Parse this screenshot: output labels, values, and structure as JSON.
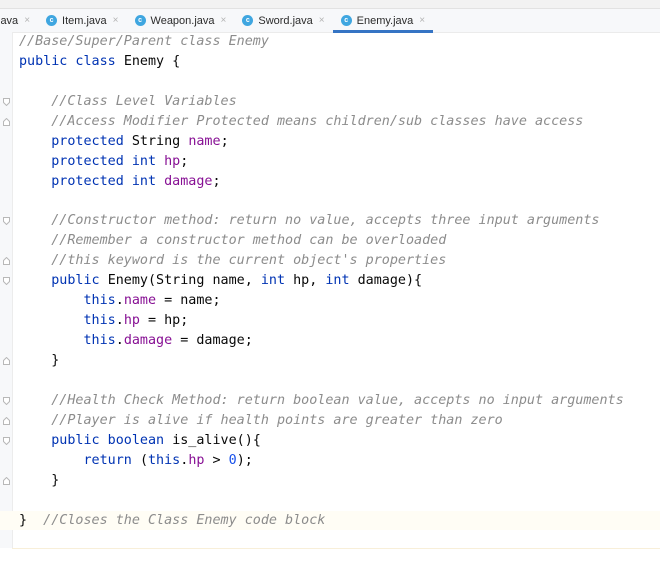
{
  "tabs": [
    {
      "label": "java",
      "icon": "java-class-icon",
      "active": false,
      "partial": true
    },
    {
      "label": "Item.java",
      "icon": "java-class-icon",
      "active": false
    },
    {
      "label": "Weapon.java",
      "icon": "java-class-icon",
      "active": false
    },
    {
      "label": "Sword.java",
      "icon": "java-class-icon",
      "active": false
    },
    {
      "label": "Enemy.java",
      "icon": "java-class-icon",
      "active": true
    }
  ],
  "tab_close_glyph": "×",
  "class_icon_glyph": "c",
  "colors": {
    "keyword": "#0033b3",
    "field": "#871094",
    "comment": "#8c8c8c",
    "number": "#1750eb",
    "text": "#080808",
    "active_tab_underline": "#3574c4",
    "class_icon": "#3fa6e0"
  },
  "editor": {
    "file_name": "Enemy.java",
    "lines": [
      [
        {
          "t": "c",
          "v": "//Base/Super/Parent class Enemy"
        }
      ],
      [
        {
          "t": "k",
          "v": "public class "
        },
        {
          "t": "t",
          "v": "Enemy {"
        }
      ],
      [],
      [
        {
          "t": "c",
          "v": "    //Class Level Variables"
        }
      ],
      [
        {
          "t": "c",
          "v": "    //Access Modifier Protected means children/sub classes have access"
        }
      ],
      [
        {
          "t": "k",
          "v": "    protected "
        },
        {
          "t": "t",
          "v": "String "
        },
        {
          "t": "f",
          "v": "name"
        },
        {
          "t": "t",
          "v": ";"
        }
      ],
      [
        {
          "t": "k",
          "v": "    protected int "
        },
        {
          "t": "f",
          "v": "hp"
        },
        {
          "t": "t",
          "v": ";"
        }
      ],
      [
        {
          "t": "k",
          "v": "    protected int "
        },
        {
          "t": "f",
          "v": "damage"
        },
        {
          "t": "t",
          "v": ";"
        }
      ],
      [],
      [
        {
          "t": "c",
          "v": "    //Constructor method: return no value, accepts three input arguments"
        }
      ],
      [
        {
          "t": "c",
          "v": "    //Remember a constructor method can be overloaded"
        }
      ],
      [
        {
          "t": "c",
          "v": "    //this keyword is the current object's properties"
        }
      ],
      [
        {
          "t": "k",
          "v": "    public "
        },
        {
          "t": "t",
          "v": "Enemy(String name, "
        },
        {
          "t": "k",
          "v": "int "
        },
        {
          "t": "t",
          "v": "hp, "
        },
        {
          "t": "k",
          "v": "int "
        },
        {
          "t": "t",
          "v": "damage){"
        }
      ],
      [
        {
          "t": "k",
          "v": "        this"
        },
        {
          "t": "t",
          "v": "."
        },
        {
          "t": "f",
          "v": "name"
        },
        {
          "t": "t",
          "v": " = name;"
        }
      ],
      [
        {
          "t": "k",
          "v": "        this"
        },
        {
          "t": "t",
          "v": "."
        },
        {
          "t": "f",
          "v": "hp"
        },
        {
          "t": "t",
          "v": " = hp;"
        }
      ],
      [
        {
          "t": "k",
          "v": "        this"
        },
        {
          "t": "t",
          "v": "."
        },
        {
          "t": "f",
          "v": "damage"
        },
        {
          "t": "t",
          "v": " = damage;"
        }
      ],
      [
        {
          "t": "t",
          "v": "    }"
        }
      ],
      [],
      [
        {
          "t": "c",
          "v": "    //Health Check Method: return boolean value, accepts no input arguments"
        }
      ],
      [
        {
          "t": "c",
          "v": "    //Player is alive if health points are greater than zero"
        }
      ],
      [
        {
          "t": "k",
          "v": "    public boolean "
        },
        {
          "t": "t",
          "v": "is_alive(){"
        }
      ],
      [
        {
          "t": "k",
          "v": "        return "
        },
        {
          "t": "t",
          "v": "("
        },
        {
          "t": "k",
          "v": "this"
        },
        {
          "t": "t",
          "v": "."
        },
        {
          "t": "f",
          "v": "hp"
        },
        {
          "t": "t",
          "v": " > "
        },
        {
          "t": "n",
          "v": "0"
        },
        {
          "t": "t",
          "v": ");"
        }
      ],
      [
        {
          "t": "t",
          "v": "    }"
        }
      ],
      [],
      [
        {
          "t": "t",
          "v": "} "
        },
        {
          "t": "c",
          "v": " //Closes the Class Enemy code block"
        }
      ]
    ],
    "fold_markers": [
      {
        "line": 3,
        "type": "fold-start"
      },
      {
        "line": 4,
        "type": "fold-end"
      },
      {
        "line": 9,
        "type": "fold-start"
      },
      {
        "line": 11,
        "type": "fold-end"
      },
      {
        "line": 12,
        "type": "fold-start"
      },
      {
        "line": 16,
        "type": "fold-end"
      },
      {
        "line": 18,
        "type": "fold-start"
      },
      {
        "line": 19,
        "type": "fold-end"
      },
      {
        "line": 20,
        "type": "fold-start"
      },
      {
        "line": 22,
        "type": "fold-end"
      }
    ],
    "current_line": 24
  }
}
